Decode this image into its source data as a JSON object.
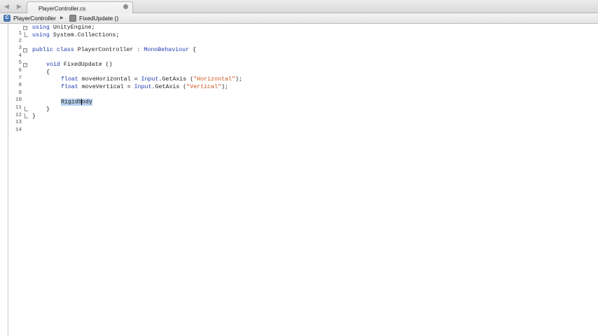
{
  "tab": {
    "title": "PlayerController.cs"
  },
  "breadcrumb": {
    "class_icon_letter": "C",
    "class_name": "PlayerController",
    "method_name": "FixedUpdate ()"
  },
  "code": {
    "l1_kw": "using",
    "l1_rest": " UnityEngine;",
    "l2_kw": "using",
    "l2_rest": " System.Collections;",
    "l4_kw1": "public",
    "l4_kw2": "class",
    "l4_name": " PlayerController : ",
    "l4_base": "MonoBehaviour",
    "l4_brace": " {",
    "l6_kw": "void",
    "l6_rest": " FixedUpdate ()",
    "l7": "{",
    "l8_kw": "float",
    "l8_mid": " moveHorizontal = ",
    "l8_type": "Input",
    "l8_call": ".GetAxis (",
    "l8_str": "\"Horizontal\"",
    "l8_end": ");",
    "l9_kw": "float",
    "l9_mid": " moveVertical = ",
    "l9_type": "Input",
    "l9_call": ".GetAxis (",
    "l9_str": "\"Vertical\"",
    "l9_end": ");",
    "l11_a": "Rigidb",
    "l11_b": "ody",
    "l12": "}",
    "l13": "}"
  },
  "line_numbers": [
    "1",
    "2",
    "3",
    "4",
    "5",
    "6",
    "7",
    "8",
    "9",
    "10",
    "11",
    "12",
    "13",
    "14"
  ],
  "colors": {
    "keyword": "#1f3bb0",
    "string": "#d0521c",
    "selection": "#b7d0ee"
  }
}
